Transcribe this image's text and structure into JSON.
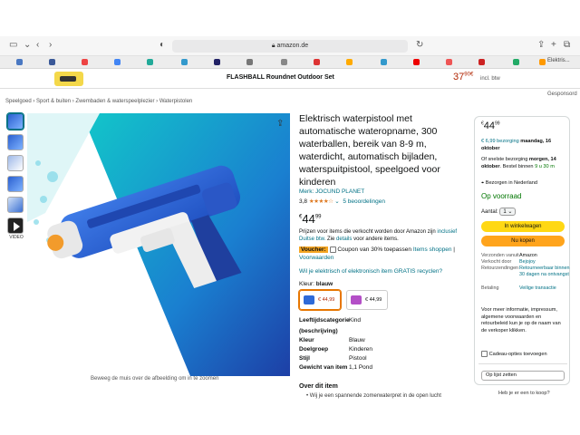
{
  "browser": {
    "url": "amazon.de"
  },
  "ad": {
    "title": "FLASHBALL Roundnet Outdoor Set",
    "price_main": "37",
    "price_frac": "90",
    "price_currency": "€",
    "btw": "incl. btw"
  },
  "gesponsord": "Gesponsord",
  "favorites": {
    "last_label": "Elektris..."
  },
  "breadcrumb": [
    "Speelgoed",
    "Sport & buiten",
    "Zwembaden & waterspeelplezier",
    "Waterpistolen"
  ],
  "gallery": {
    "video_label": "VIDEO",
    "zoom_hint": "Beweeg de muis over de afbeelding om in te zoomen"
  },
  "product": {
    "title": "Elektrisch waterpistool met automatische wateropname, 300 waterballen, bereik van 8-9 m, waterdicht, automatisch bijladen, waterspuitpistool, speelgoed voor kinderen",
    "brand": "Merk: JOCUND PLANET",
    "rating_value": "3,8",
    "rating_stars": 3.8,
    "rating_count": "5 beoordelingen",
    "price_currency": "€",
    "price_main": "44",
    "price_frac": "99",
    "price_note_1": "Prijzen voor items die verkocht worden door Amazon zijn",
    "price_note_link": "inclusief Duitse btw.",
    "price_note_2": "Zie",
    "price_note_link2": "details",
    "price_note_3": "voor andere items.",
    "voucher_badge": "Voucher:",
    "voucher_text": "Coupon van 30% toepassen",
    "voucher_link1": "Items shoppen",
    "voucher_sep": "|",
    "voucher_link2": "Voorwaarden",
    "electric_link": "Wil je elektrisch of elektronisch item GRATIS recyclen?",
    "color_label": "Kleur:",
    "color_value": "blauw",
    "variants": [
      {
        "price": "€ 44,99",
        "color": "#2d6ad8"
      },
      {
        "price": "€ 44,99",
        "color": "#b44fc7"
      }
    ],
    "specs": [
      {
        "k": "Leeftijdscategorie (beschrijving)",
        "v": "Kind"
      },
      {
        "k": "Kleur",
        "v": "Blauw"
      },
      {
        "k": "Doelgroep",
        "v": "Kinderen"
      },
      {
        "k": "Stijl",
        "v": "Pistool"
      },
      {
        "k": "Gewicht van item",
        "v": "1,1 Pond"
      }
    ],
    "about_title": "Over dit item",
    "about_first": "Wij je een spannende zomerwaterpret in de open lucht"
  },
  "buybox": {
    "price_currency": "€",
    "price_main": "44",
    "price_frac": "99",
    "delivery_1": "€ 6,99 bezorging",
    "delivery_1_bold": "maandag, 16 oktober",
    "delivery_2_pre": "Of snelste bezorging",
    "delivery_2_bold": "morgen, 14 oktober",
    "delivery_2_mid": ". Bestel binnen",
    "delivery_2_time": "9 u 30 m",
    "deliver_to": "Bezorgen in Nederland",
    "stock": "Op voorraad",
    "qty_label": "Aantal:",
    "qty_value": "1",
    "cart_label": "In winkelwagen",
    "buy_label": "Nu kopen",
    "table": [
      {
        "k": "Verzonden vanuit",
        "v": "Amazon",
        "link": false
      },
      {
        "k": "Verkocht door",
        "v": "Bejojoy",
        "link": true
      },
      {
        "k": "Retourzendingen",
        "v": "Retourneerbaar binnen 30 dagen na ontvangst",
        "link": true
      },
      {
        "k": "Betaling",
        "v": "Veilige transactie",
        "link": true
      }
    ],
    "more_info": "Voor meer informatie, impressum, algemene voorwaarden en retourbeleid kun je op de naam van de verkoper klikken.",
    "gift": "Cadeau-opties toevoegen",
    "wishlist": "Op lijst zetten",
    "cheaper": "Heb je er een to koop?"
  },
  "colors": {
    "link": "#007185",
    "price_red": "#b12704",
    "cart_yellow": "#ffd814",
    "buy_orange": "#ffa41c",
    "stock_green": "#007600"
  }
}
